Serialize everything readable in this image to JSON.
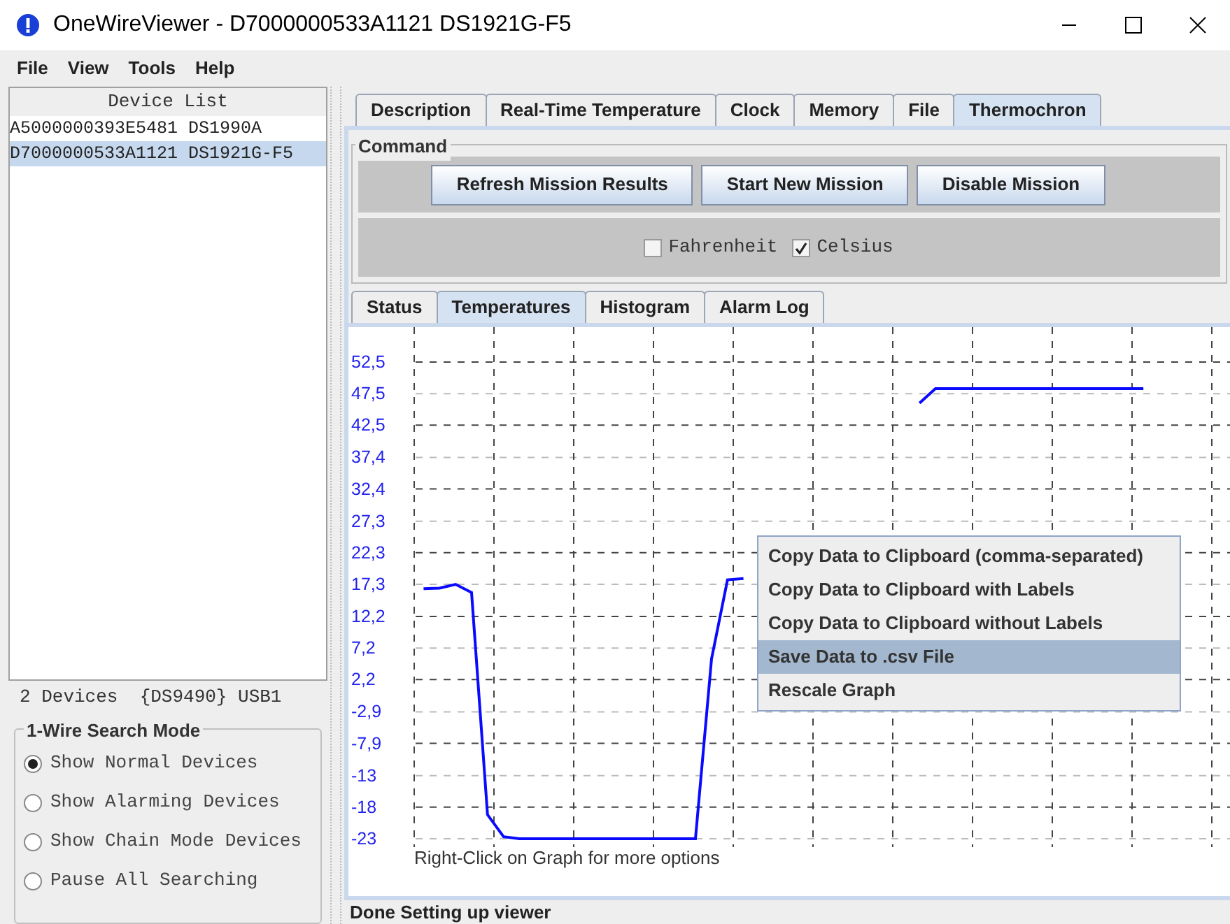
{
  "window": {
    "title": "OneWireViewer - D7000000533A1121 DS1921G-F5"
  },
  "menu_bar": [
    "File",
    "View",
    "Tools",
    "Help"
  ],
  "device_list": {
    "header": "Device List",
    "items": [
      {
        "label": "A5000000393E5481 DS1990A",
        "selected": false
      },
      {
        "label": "D7000000533A1121 DS1921G-F5",
        "selected": true
      }
    ]
  },
  "device_count": "2 Devices  {DS9490} USB1",
  "search_mode": {
    "title": "1-Wire Search Mode",
    "options": [
      {
        "label": "Show Normal Devices",
        "selected": true
      },
      {
        "label": "Show Alarming Devices",
        "selected": false
      },
      {
        "label": "Show Chain Mode Devices",
        "selected": false
      },
      {
        "label": "Pause All Searching",
        "selected": false
      }
    ]
  },
  "tabs": [
    {
      "label": "Description",
      "selected": false
    },
    {
      "label": "Real-Time Temperature",
      "selected": false
    },
    {
      "label": "Clock",
      "selected": false
    },
    {
      "label": "Memory",
      "selected": false
    },
    {
      "label": "File",
      "selected": false
    },
    {
      "label": "Thermochron",
      "selected": true
    }
  ],
  "command": {
    "title": "Command",
    "buttons": [
      "Refresh Mission Results",
      "Start New Mission",
      "Disable Mission"
    ],
    "units": [
      {
        "label": "Fahrenheit",
        "checked": false
      },
      {
        "label": "Celsius",
        "checked": true
      }
    ]
  },
  "sub_tabs": [
    {
      "label": "Status",
      "selected": false
    },
    {
      "label": "Temperatures",
      "selected": true
    },
    {
      "label": "Histogram",
      "selected": false
    },
    {
      "label": "Alarm Log",
      "selected": false
    }
  ],
  "graph": {
    "chart_data": {
      "type": "line",
      "ylim": [
        -23,
        52.5
      ],
      "grid": true,
      "yticks": [
        {
          "value": 52.5,
          "label": "52,5"
        },
        {
          "value": 47.5,
          "label": "47,5"
        },
        {
          "value": 42.5,
          "label": "42,5"
        },
        {
          "value": 37.4,
          "label": "37,4"
        },
        {
          "value": 32.4,
          "label": "32,4"
        },
        {
          "value": 27.3,
          "label": "27,3"
        },
        {
          "value": 22.3,
          "label": "22,3"
        },
        {
          "value": 17.3,
          "label": "17,3"
        },
        {
          "value": 12.2,
          "label": "12,2"
        },
        {
          "value": 7.2,
          "label": "7,2"
        },
        {
          "value": 2.2,
          "label": "2,2"
        },
        {
          "value": -2.9,
          "label": "-2,9"
        },
        {
          "value": -7.9,
          "label": "-7,9"
        },
        {
          "value": -13,
          "label": "-13"
        },
        {
          "value": -18,
          "label": "-18"
        },
        {
          "value": -23,
          "label": "-23"
        }
      ],
      "categories": [
        null,
        null,
        null,
        null,
        null,
        null,
        null,
        null,
        null,
        null,
        null,
        null,
        null,
        null,
        null,
        null,
        null,
        null,
        null,
        null,
        null,
        null,
        null,
        null,
        null,
        null,
        null,
        null,
        null,
        null,
        null,
        null,
        null,
        null,
        null,
        null,
        null,
        null,
        null,
        null,
        null,
        null,
        null,
        null,
        null,
        null,
        null,
        null,
        null,
        null,
        null
      ],
      "series": [
        {
          "color": "#0a0aff",
          "values": [
            16.6,
            16.7,
            17.3,
            16.0,
            -19.2,
            -22.7,
            -23,
            -23,
            -23,
            -23,
            -23,
            -23,
            -23,
            -23,
            -23,
            -23,
            -23,
            -23,
            5.5,
            18.0,
            18.2,
            null,
            null,
            null,
            null,
            null,
            null,
            null,
            null,
            null,
            null,
            46.0,
            48.3,
            48.3,
            48.3,
            48.3,
            48.3,
            48.3,
            48.3,
            48.3,
            48.3,
            48.3,
            48.3,
            48.3,
            48.3,
            48.3,
            null,
            null,
            null,
            null,
            null
          ]
        }
      ]
    },
    "hint": "Right-Click on Graph for more options"
  },
  "context_menu": [
    {
      "label": "Copy Data to Clipboard (comma-separated)",
      "selected": false
    },
    {
      "label": "Copy Data to Clipboard with Labels",
      "selected": false
    },
    {
      "label": "Copy Data to Clipboard without Labels",
      "selected": false
    },
    {
      "label": "Save Data to .csv File",
      "selected": true
    },
    {
      "label": "Rescale Graph",
      "selected": false
    }
  ],
  "status_bar": "Done Setting up viewer"
}
